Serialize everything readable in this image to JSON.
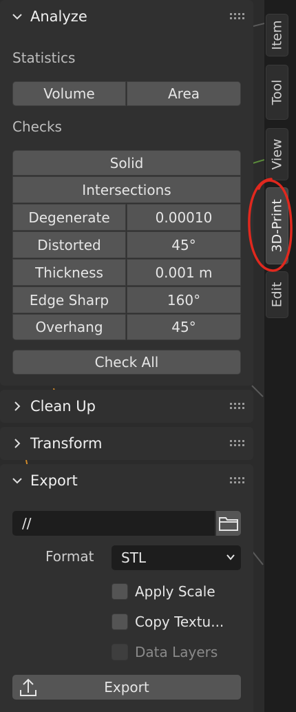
{
  "tabs": [
    {
      "label": "Item",
      "active": false
    },
    {
      "label": "Tool",
      "active": false
    },
    {
      "label": "View",
      "active": false
    },
    {
      "label": "3D-Print",
      "active": true
    },
    {
      "label": "Edit",
      "active": false
    }
  ],
  "analyze": {
    "title": "Analyze",
    "expanded": true,
    "statistics_label": "Statistics",
    "volume_button": "Volume",
    "area_button": "Area",
    "checks_label": "Checks",
    "solid_button": "Solid",
    "intersections_button": "Intersections",
    "checks": [
      {
        "label": "Degenerate",
        "value": "0.00010"
      },
      {
        "label": "Distorted",
        "value": "45°"
      },
      {
        "label": "Thickness",
        "value": "0.001 m"
      },
      {
        "label": "Edge Sharp",
        "value": "160°"
      },
      {
        "label": "Overhang",
        "value": "45°"
      }
    ],
    "check_all_button": "Check All"
  },
  "cleanup": {
    "title": "Clean Up",
    "expanded": false
  },
  "transform": {
    "title": "Transform",
    "expanded": false
  },
  "export": {
    "title": "Export",
    "expanded": true,
    "path_value": "//",
    "format_label": "Format",
    "format_value": "STL",
    "apply_scale": {
      "label": "Apply Scale",
      "checked": false
    },
    "copy_textures": {
      "label": "Copy Textu...",
      "checked": false
    },
    "data_layers": {
      "label": "Data Layers",
      "checked": false,
      "disabled": true
    },
    "export_button": "Export"
  },
  "colors": {
    "panel_bg": "#303030",
    "button_bg": "#555555",
    "input_bg": "#1d1d1d",
    "annotation_circle": "#e0281e"
  },
  "icons": [
    "chevron-down-icon",
    "chevron-right-icon",
    "drag-grip-icon",
    "folder-icon",
    "export-upload-icon",
    "dropdown-arrow-icon"
  ]
}
